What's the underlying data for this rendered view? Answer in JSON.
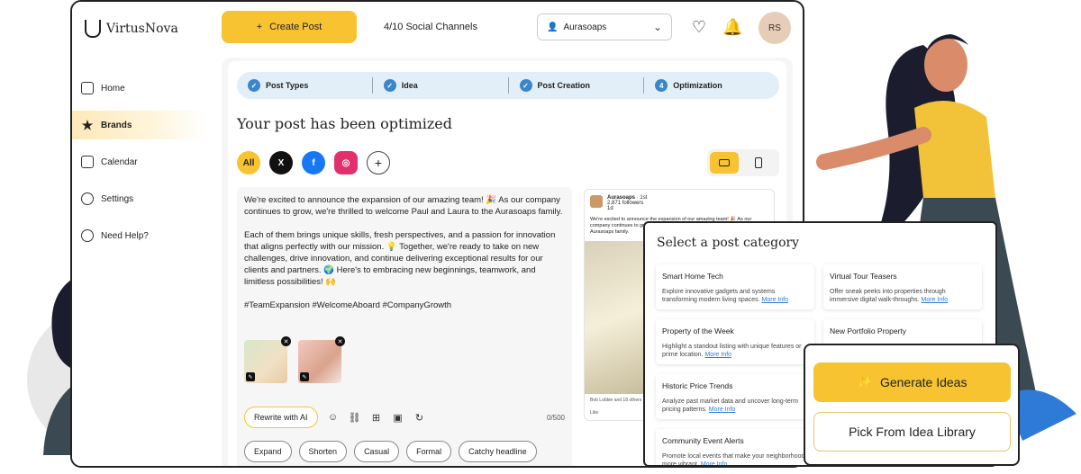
{
  "app": {
    "logo_text": "VirtusNova"
  },
  "sidebar": {
    "items": [
      {
        "label": "Home",
        "icon": "home-icon"
      },
      {
        "label": "Brands",
        "icon": "star-icon",
        "active": true
      },
      {
        "label": "Calendar",
        "icon": "calendar-icon"
      },
      {
        "label": "Settings",
        "icon": "gear-icon"
      },
      {
        "label": "Need Help?",
        "icon": "help-icon"
      }
    ]
  },
  "topbar": {
    "create_label": "Create Post",
    "channels_text": "4/10  Social Channels",
    "brand_value": "Aurasoaps",
    "avatar_initials": "RS"
  },
  "stepper": {
    "steps": [
      {
        "label": "Post Types",
        "state": "done"
      },
      {
        "label": "Idea",
        "state": "done"
      },
      {
        "label": "Post Creation",
        "state": "done"
      },
      {
        "label": "Optimization",
        "state": "current",
        "number": "4"
      }
    ]
  },
  "main": {
    "title": "Your post has been optimized",
    "socials": {
      "all_label": "All",
      "x_label": "X",
      "fb_label": "f",
      "ig_label": "◎",
      "add_label": "+"
    },
    "post_text": "We're excited to announce the expansion of our amazing team! 🎉 As our company continues to grow, we're thrilled to welcome Paul and Laura to the Aurasoaps family.\n\nEach of them brings unique skills, fresh perspectives, and a passion for innovation that aligns perfectly with our mission. 💡 Together, we're ready to take on new challenges, drive innovation, and continue delivering exceptional results for our clients and partners. 🌍 Here's to embracing new beginnings, teamwork, and limitless possibilities! 🙌\n\n#TeamExpansion #WelcomeAboard #CompanyGrowth",
    "rewrite_label": "Rewrite with AI",
    "char_count": "0/500",
    "chips": [
      "Expand",
      "Shorten",
      "Casual",
      "Formal",
      "Catchy headline"
    ]
  },
  "preview": {
    "name": "Aurasoaps",
    "meta": "1st",
    "followers": "2,871 followers",
    "time": "1d",
    "text": "We're excited to announce the expansion of our amazing team! 🎉 As our company continues to grow, we're thrilled to welcome Paul and Laura to the Aurasoaps family.",
    "footer": "Bob Lobbie and 18 others",
    "like": "Like"
  },
  "category_panel": {
    "title": "Select a post category",
    "more_label": "More Info",
    "items": [
      {
        "name": "Smart Home Tech",
        "desc": "Explore innovative gadgets and systems transforming modern living spaces."
      },
      {
        "name": "Virtual Tour Teasers",
        "desc": "Offer sneak peeks into properties through immersive digital walk-throughs."
      },
      {
        "name": "Property of the Week",
        "desc": "Highlight a standout listing with unique features or prime location."
      },
      {
        "name": "New Portfolio Property",
        "desc": ""
      },
      {
        "name": "Historic Price Trends",
        "desc": "Analyze past market data and uncover long-term pricing patterns."
      },
      {
        "name": "Community Event Alerts",
        "desc": "Promote local events that make your neighborhoods more vibrant."
      }
    ]
  },
  "idea_panel": {
    "generate_label": "Generate Ideas",
    "pick_label": "Pick From Idea Library"
  },
  "colors": {
    "accent": "#f7c331",
    "step_blue": "#3a86c8",
    "stepper_bg": "#e3eff8"
  }
}
